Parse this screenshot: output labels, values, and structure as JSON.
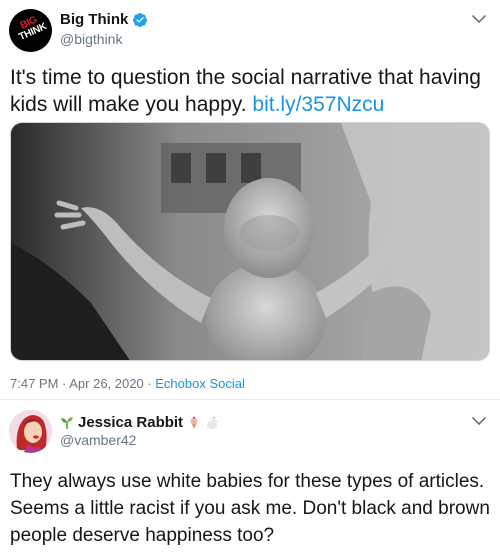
{
  "tweet": {
    "display_name": "Big Think",
    "handle": "@bigthink",
    "avatar_logo_lines": [
      "BIG",
      "THINK"
    ],
    "text": "It's time to question the social narrative that having kids will make you happy. ",
    "link": "bit.ly/357Nzcu",
    "image_icon": "newborn-baby-photo",
    "timestamp": "7:47 PM · Apr 26, 2020 · ",
    "source": "Echobox Social"
  },
  "reply": {
    "display_name": "Jessica Rabbit",
    "handle": "@vamber42",
    "text": "They always use white babies for these types of articles. Seems a little racist if you ask me. Don't black and brown people deserve happiness too?",
    "name_icons": [
      "sprout-icon",
      "ice-cream-icon",
      "chicken-icon"
    ]
  },
  "colors": {
    "link": "#1b95e0",
    "verified": "#1da1f2",
    "secondary_text": "#657786",
    "primary_text": "#14171a"
  }
}
